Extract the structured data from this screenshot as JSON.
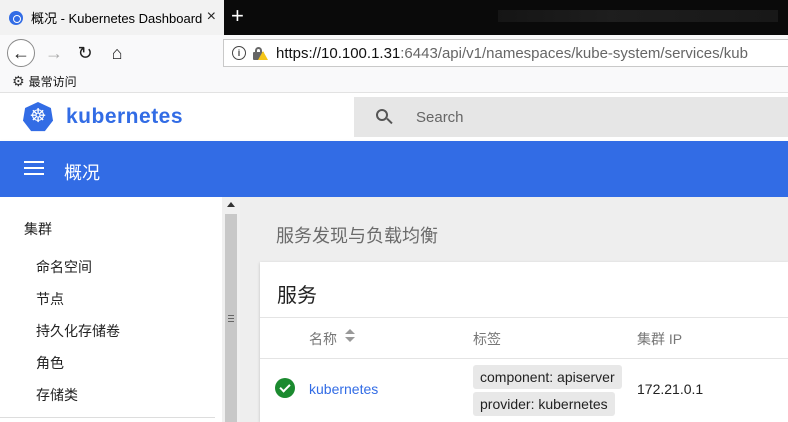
{
  "browser": {
    "tab_title": "概况 - Kubernetes Dashboard",
    "tab_close": "×",
    "new_tab": "+",
    "url_host": "https://10.100.1.31",
    "url_path": ":6443/api/v1/namespaces/kube-system/services/kub",
    "bookmark": "最常访问"
  },
  "header": {
    "brand": "kubernetes",
    "search_placeholder": "Search"
  },
  "toolbar": {
    "title": "概况"
  },
  "sidebar": {
    "group": "集群",
    "items": [
      "命名空间",
      "节点",
      "持久化存储卷",
      "角色",
      "存储类"
    ]
  },
  "main": {
    "section_title": "服务发现与负载均衡",
    "card_title": "服务",
    "columns": [
      "名称",
      "标签",
      "集群 IP"
    ],
    "rows": [
      {
        "name": "kubernetes",
        "labels": [
          "component: apiserver",
          "provider: kubernetes"
        ],
        "cluster_ip": "172.21.0.1",
        "status": "ok"
      }
    ]
  },
  "colors": {
    "brand_blue": "#326ce5",
    "status_ok": "#1b8a2f"
  }
}
